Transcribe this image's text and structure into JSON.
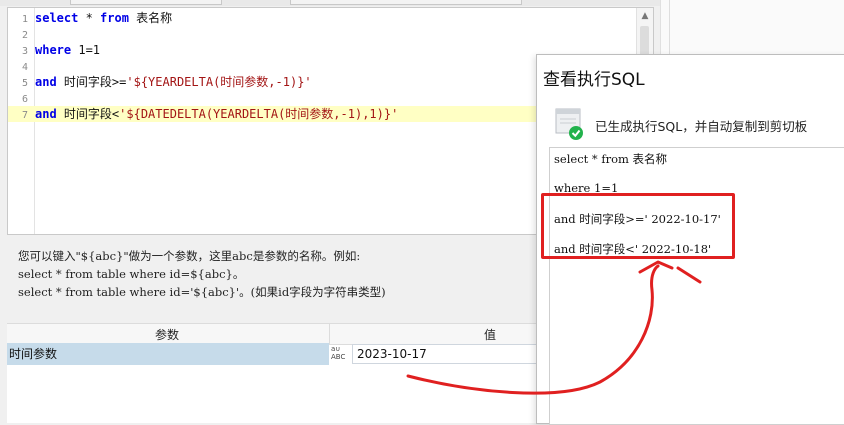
{
  "editor": {
    "lines": [
      {
        "num": "1",
        "parts": [
          {
            "t": "select",
            "c": "kw"
          },
          {
            "t": " * ",
            "c": "tx"
          },
          {
            "t": "from",
            "c": "kw"
          },
          {
            "t": " 表名称",
            "c": "tx"
          }
        ]
      },
      {
        "num": "2",
        "parts": []
      },
      {
        "num": "3",
        "parts": [
          {
            "t": "where",
            "c": "kw"
          },
          {
            "t": " 1=1",
            "c": "tx"
          }
        ]
      },
      {
        "num": "4",
        "parts": []
      },
      {
        "num": "5",
        "parts": [
          {
            "t": "and",
            "c": "kw"
          },
          {
            "t": " 时间字段>=",
            "c": "tx"
          },
          {
            "t": "'${YEARDELTA(时间参数,-1)}'",
            "c": "st"
          }
        ]
      },
      {
        "num": "6",
        "parts": []
      },
      {
        "num": "7",
        "parts": [
          {
            "t": "and",
            "c": "kw"
          },
          {
            "t": " 时间字段<",
            "c": "tx"
          },
          {
            "t": "'${DATEDELTA(YEARDELTA(时间参数,-1),1)}'",
            "c": "st"
          }
        ],
        "highlight": true
      }
    ]
  },
  "hint": {
    "line1": "您可以键入\"${abc}\"做为一个参数，这里abc是参数的名称。例如:",
    "line2": "select * from table where id=${abc}。",
    "line3": "select * from table where id='${abc}'。(如果id字段为字符串类型)"
  },
  "params": {
    "col_param": "参数",
    "col_value": "值",
    "row_name": "时间参数",
    "row_type": "ABC",
    "row_value": "2023-10-17"
  },
  "dialog": {
    "title": "查看执行SQL",
    "message": "已生成执行SQL，并自动复制到剪切板",
    "result_lines": [
      "select * from 表名称",
      "where 1=1",
      "and 时间字段>=' 2022-10-17'",
      "and 时间字段<' 2022-10-18'"
    ]
  },
  "colors": {
    "keyword": "#0000e6",
    "string": "#a31515",
    "annotation": "#e02020",
    "selected_row": "#c6dbea"
  }
}
